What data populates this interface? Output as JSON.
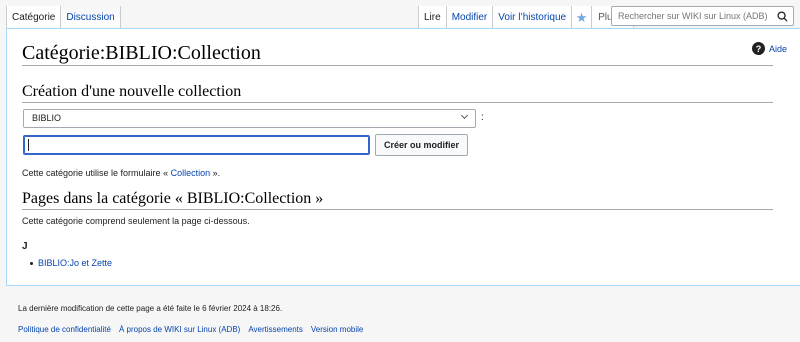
{
  "tabs": {
    "left": [
      "Catégorie",
      "Discussion"
    ],
    "right": [
      "Lire",
      "Modifier",
      "Voir l’historique"
    ],
    "more_label": "Plus"
  },
  "search": {
    "placeholder": "Rechercher sur WIKI sur Linux (ADB)"
  },
  "page": {
    "title": "Catégorie:BIBLIO:Collection",
    "help_label": "Aide"
  },
  "creation": {
    "heading": "Création d'une nouvelle collection",
    "select_value": "BIBLIO",
    "colon": ":",
    "input_value": "",
    "button_label": "Créer ou modifier",
    "form_note_prefix": "Cette catégorie utilise le formulaire «",
    "form_note_link": "Collection",
    "form_note_suffix": "»."
  },
  "category_pages": {
    "heading": "Pages dans la catégorie « BIBLIO:Collection  »",
    "description": "Cette catégorie comprend seulement la page ci-dessous.",
    "letter": "J",
    "items": [
      "BIBLIO:Jo et Zette"
    ]
  },
  "footer": {
    "last_modified": "La dernière modification de cette page a été faite le 6 février 2024 à 18:26.",
    "links": [
      "Politique de confidentialité",
      "À propos de WIKI sur Linux (ADB)",
      "Avertissements",
      "Version mobile"
    ]
  },
  "colors": {
    "link": "#0645ad",
    "border": "#a7d7f9",
    "focus": "#3366cc"
  }
}
